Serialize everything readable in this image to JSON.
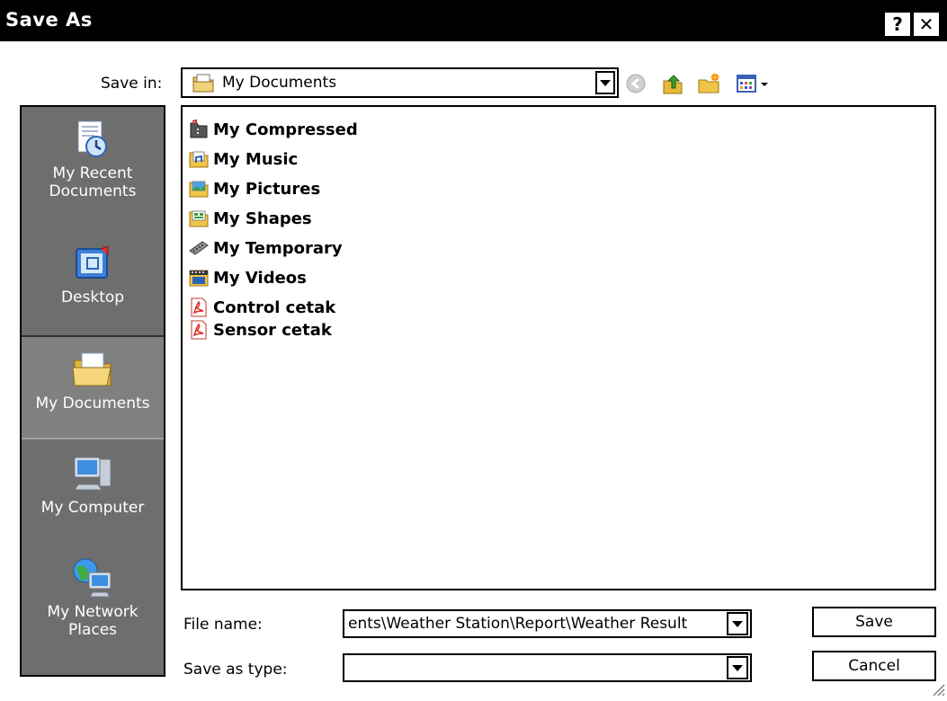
{
  "window": {
    "title": "Save As",
    "help_label": "?",
    "close_label": "✕"
  },
  "save_in": {
    "label": "Save in:",
    "value": "My Documents"
  },
  "toolbar": {
    "icons": [
      "back-icon",
      "up-one-level-icon",
      "new-folder-icon",
      "view-menu-icon"
    ]
  },
  "places": {
    "items": [
      {
        "label": "My Recent\nDocuments",
        "icon": "recent-documents-icon"
      },
      {
        "label": "Desktop",
        "icon": "desktop-icon"
      },
      {
        "label": "My Documents",
        "icon": "my-documents-icon",
        "selected": true
      },
      {
        "label": "My Computer",
        "icon": "my-computer-icon"
      },
      {
        "label": "My Network\nPlaces",
        "icon": "network-places-icon"
      }
    ]
  },
  "files": [
    {
      "name": "My Compressed",
      "icon": "compressed-folder-icon"
    },
    {
      "name": "My Music",
      "icon": "music-folder-icon"
    },
    {
      "name": "My Pictures",
      "icon": "pictures-folder-icon"
    },
    {
      "name": "My Shapes",
      "icon": "shapes-folder-icon"
    },
    {
      "name": "My Temporary",
      "icon": "temporary-folder-icon"
    },
    {
      "name": "My Videos",
      "icon": "videos-folder-icon"
    },
    {
      "name": "Control cetak",
      "icon": "pdf-file-icon"
    },
    {
      "name": "Sensor cetak",
      "icon": "pdf-file-icon"
    }
  ],
  "file_name": {
    "label": "File name:",
    "value": "ents\\Weather Station\\Report\\Weather Result"
  },
  "save_as_type": {
    "label": "Save as type:",
    "value": ""
  },
  "buttons": {
    "save": "Save",
    "cancel": "Cancel"
  },
  "colors": {
    "titlebar": "#000000",
    "places_bg": "#6e6e6e"
  }
}
